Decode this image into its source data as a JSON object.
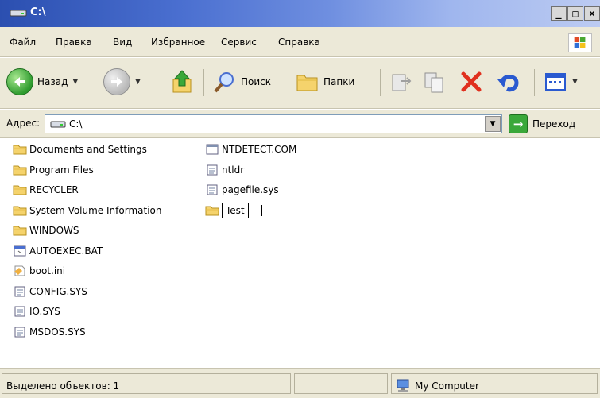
{
  "window": {
    "title": "C:\\"
  },
  "menu": [
    "Файл",
    "Правка",
    "Вид",
    "Избранное",
    "Сервис",
    "Справка"
  ],
  "toolbar": {
    "back_label": "Назад",
    "search_label": "Поиск",
    "folders_label": "Папки"
  },
  "address": {
    "label": "Адрес:",
    "value": "C:\\",
    "go_label": "Переход"
  },
  "files": {
    "column1": [
      {
        "name": "Documents and Settings",
        "type": "folder"
      },
      {
        "name": "Program Files",
        "type": "folder"
      },
      {
        "name": "RECYCLER",
        "type": "folder"
      },
      {
        "name": "System Volume Information",
        "type": "folder"
      },
      {
        "name": "WINDOWS",
        "type": "folder"
      },
      {
        "name": "AUTOEXEC.BAT",
        "type": "bat"
      },
      {
        "name": "boot.ini",
        "type": "ini"
      },
      {
        "name": "CONFIG.SYS",
        "type": "sys"
      },
      {
        "name": "IO.SYS",
        "type": "sys"
      },
      {
        "name": "MSDOS.SYS",
        "type": "sys"
      }
    ],
    "column2": [
      {
        "name": "NTDETECT.COM",
        "type": "com"
      },
      {
        "name": "ntldr",
        "type": "sys"
      },
      {
        "name": "pagefile.sys",
        "type": "sys"
      },
      {
        "name": "Test",
        "type": "folder",
        "renaming": true
      }
    ]
  },
  "status": {
    "selected": "Выделено объектов: 1",
    "location": "My Computer"
  },
  "colors": {
    "title_start": "#2b4fb0",
    "chrome": "#ece9d8",
    "folder": "#f5d36c",
    "close_x": "#e0301e"
  }
}
